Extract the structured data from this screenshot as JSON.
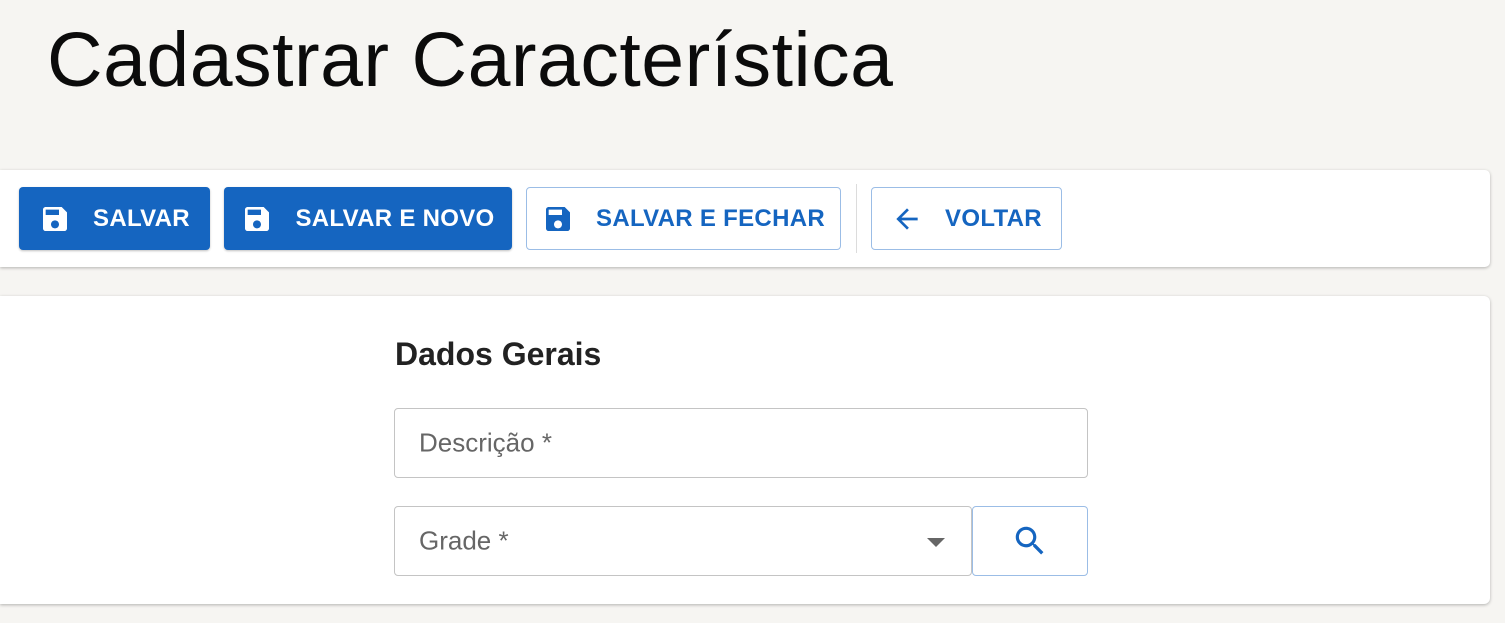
{
  "page": {
    "title": "Cadastrar Característica"
  },
  "toolbar": {
    "salvar_label": "SALVAR",
    "salvar_novo_label": "SALVAR E NOVO",
    "salvar_fechar_label": "SALVAR E FECHAR",
    "voltar_label": "VOLTAR"
  },
  "form": {
    "section_title": "Dados Gerais",
    "descricao": {
      "placeholder": "Descrição *",
      "value": ""
    },
    "grade": {
      "placeholder": "Grade *",
      "value": ""
    }
  },
  "icons": {
    "save": "save-icon",
    "back": "arrow-left-icon",
    "search": "search-icon",
    "dropdown": "chevron-down-icon"
  },
  "colors": {
    "primary": "#1565c0",
    "background": "#f6f5f2",
    "surface": "#ffffff",
    "outline": "#9bbde6"
  }
}
